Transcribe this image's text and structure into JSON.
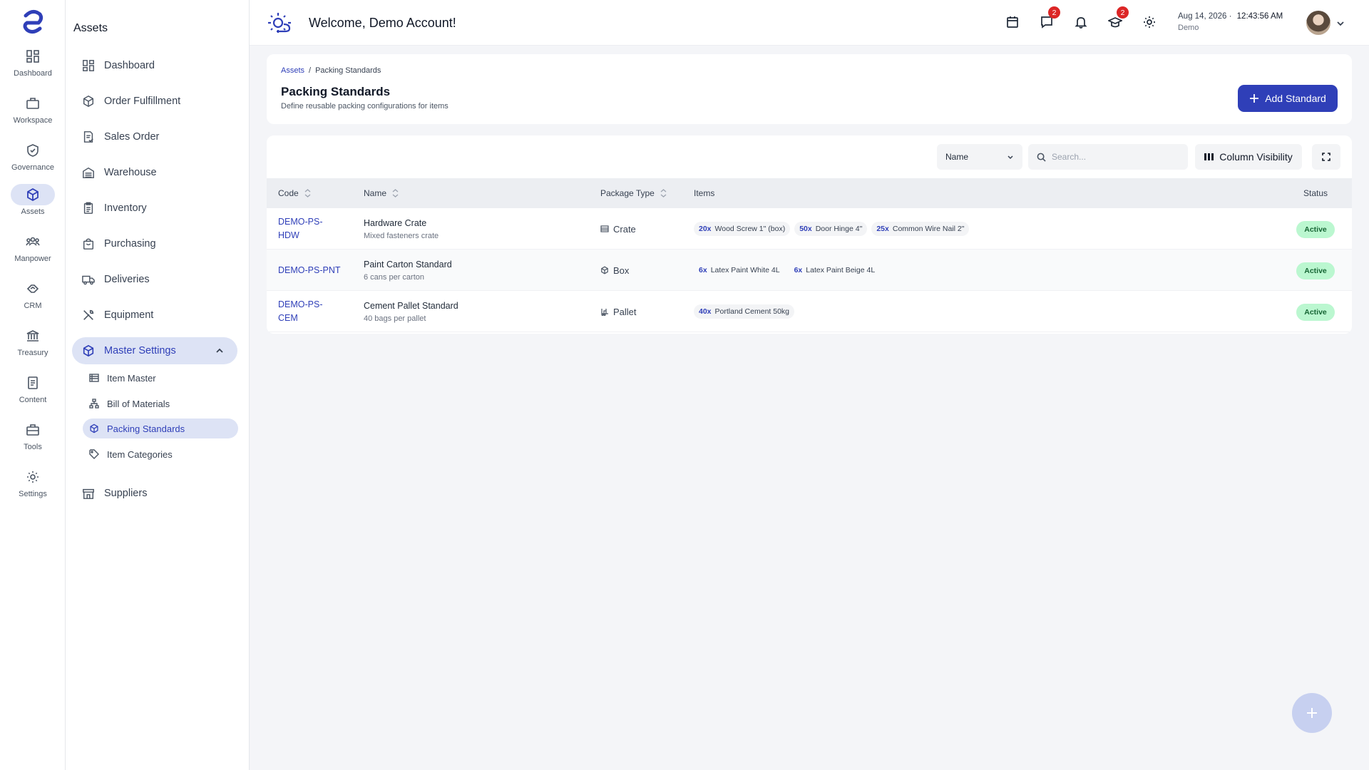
{
  "rail": {
    "items": [
      {
        "label": "Dashboard",
        "icon": "dashboard-icon"
      },
      {
        "label": "Workspace",
        "icon": "briefcase-icon"
      },
      {
        "label": "Governance",
        "icon": "shield-icon"
      },
      {
        "label": "Assets",
        "icon": "cube-icon",
        "active": true
      },
      {
        "label": "Manpower",
        "icon": "people-icon"
      },
      {
        "label": "CRM",
        "icon": "handshake-icon"
      },
      {
        "label": "Treasury",
        "icon": "bank-icon"
      },
      {
        "label": "Content",
        "icon": "document-icon"
      },
      {
        "label": "Tools",
        "icon": "toolbox-icon"
      },
      {
        "label": "Settings",
        "icon": "gear-icon"
      }
    ]
  },
  "sidebar": {
    "title": "Assets",
    "items": [
      {
        "label": "Dashboard",
        "icon": "dashboard-icon"
      },
      {
        "label": "Order Fulfillment",
        "icon": "box-icon"
      },
      {
        "label": "Sales Order",
        "icon": "receipt-icon"
      },
      {
        "label": "Warehouse",
        "icon": "warehouse-icon"
      },
      {
        "label": "Inventory",
        "icon": "clipboard-icon"
      },
      {
        "label": "Purchasing",
        "icon": "shopping-bag-icon"
      },
      {
        "label": "Deliveries",
        "icon": "truck-icon"
      },
      {
        "label": "Equipment",
        "icon": "wrench-icon"
      },
      {
        "label": "Master Settings",
        "icon": "cube-icon",
        "expanded": true
      },
      {
        "label": "Suppliers",
        "icon": "store-icon"
      }
    ],
    "sub_items": [
      {
        "label": "Item Master",
        "icon": "table-icon"
      },
      {
        "label": "Bill of Materials",
        "icon": "hierarchy-icon"
      },
      {
        "label": "Packing Standards",
        "icon": "package-icon",
        "active": true
      },
      {
        "label": "Item Categories",
        "icon": "tag-icon"
      }
    ]
  },
  "header": {
    "title": "Welcome, Demo Account!",
    "messages_badge": "2",
    "academy_badge": "2",
    "date": "Aug 14, 2026",
    "time": "12:43:56 AM",
    "user": "Demo"
  },
  "page": {
    "breadcrumb_root": "Assets",
    "breadcrumb_sep": "/",
    "breadcrumb_current": "Packing Standards",
    "title": "Packing Standards",
    "subtitle": "Define reusable packing configurations for items",
    "add_button": "Add Standard"
  },
  "toolbar": {
    "sort_field": "Name",
    "search_placeholder": "Search...",
    "column_visibility": "Column Visibility"
  },
  "table": {
    "columns": {
      "code": "Code",
      "name": "Name",
      "package_type": "Package Type",
      "items": "Items",
      "status": "Status"
    },
    "rows": [
      {
        "code_line1": "DEMO-PS-",
        "code_line2": "HDW",
        "name": "Hardware Crate",
        "description": "Mixed fasteners crate",
        "package_type": "Crate",
        "package_icon": "crate-icon",
        "items": [
          {
            "qty": "20x",
            "name": "Wood Screw 1\" (box)"
          },
          {
            "qty": "50x",
            "name": "Door Hinge 4\""
          },
          {
            "qty": "25x",
            "name": "Common Wire Nail 2\""
          }
        ],
        "status": "Active"
      },
      {
        "code_line1": "DEMO-PS-PNT",
        "code_line2": "",
        "name": "Paint Carton Standard",
        "description": "6 cans per carton",
        "package_type": "Box",
        "package_icon": "box-icon",
        "items": [
          {
            "qty": "6x",
            "name": "Latex Paint White 4L"
          },
          {
            "qty": "6x",
            "name": "Latex Paint Beige 4L"
          }
        ],
        "status": "Active"
      },
      {
        "code_line1": "DEMO-PS-",
        "code_line2": "CEM",
        "name": "Cement Pallet Standard",
        "description": "40 bags per pallet",
        "package_type": "Pallet",
        "package_icon": "forklift-icon",
        "items": [
          {
            "qty": "40x",
            "name": "Portland Cement 50kg"
          }
        ],
        "status": "Active"
      }
    ]
  },
  "colors": {
    "accent": "#2f3fb8",
    "active_bg": "#dde3f5",
    "status_bg": "#bbf7d0",
    "status_text": "#166534",
    "badge": "#dc2626"
  }
}
